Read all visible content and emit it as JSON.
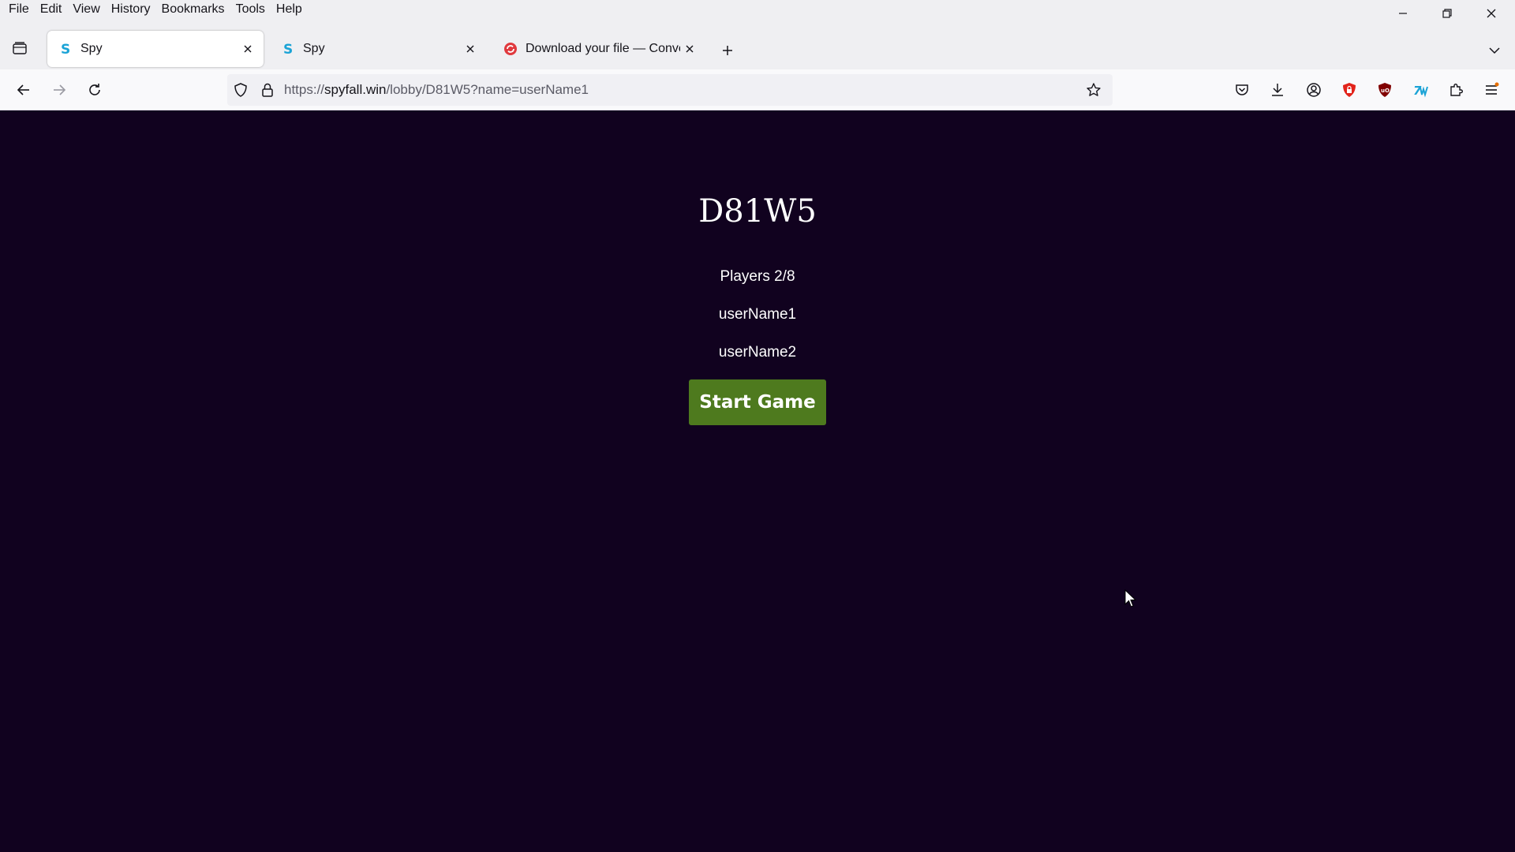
{
  "menu": [
    "File",
    "Edit",
    "View",
    "History",
    "Bookmarks",
    "Tools",
    "Help"
  ],
  "tabs": [
    {
      "title": "Spy",
      "active": true,
      "favicon": "spyfall-s-icon"
    },
    {
      "title": "Spy",
      "active": false,
      "favicon": "spyfall-s-icon"
    },
    {
      "title": "Download your file — Converti",
      "active": false,
      "favicon": "convertio-icon"
    }
  ],
  "address": {
    "prefix": "https://",
    "host": "spyfall.win",
    "path": "/lobby/D81W5?name=userName1"
  },
  "lobby": {
    "room_code": "D81W5",
    "players_label": "Players 2/8",
    "players": [
      "userName1",
      "userName2"
    ],
    "start_button": "Start Game"
  },
  "colors": {
    "page_background": "#11021f",
    "start_button": "#4e7a1e",
    "text": "#ffffff"
  }
}
